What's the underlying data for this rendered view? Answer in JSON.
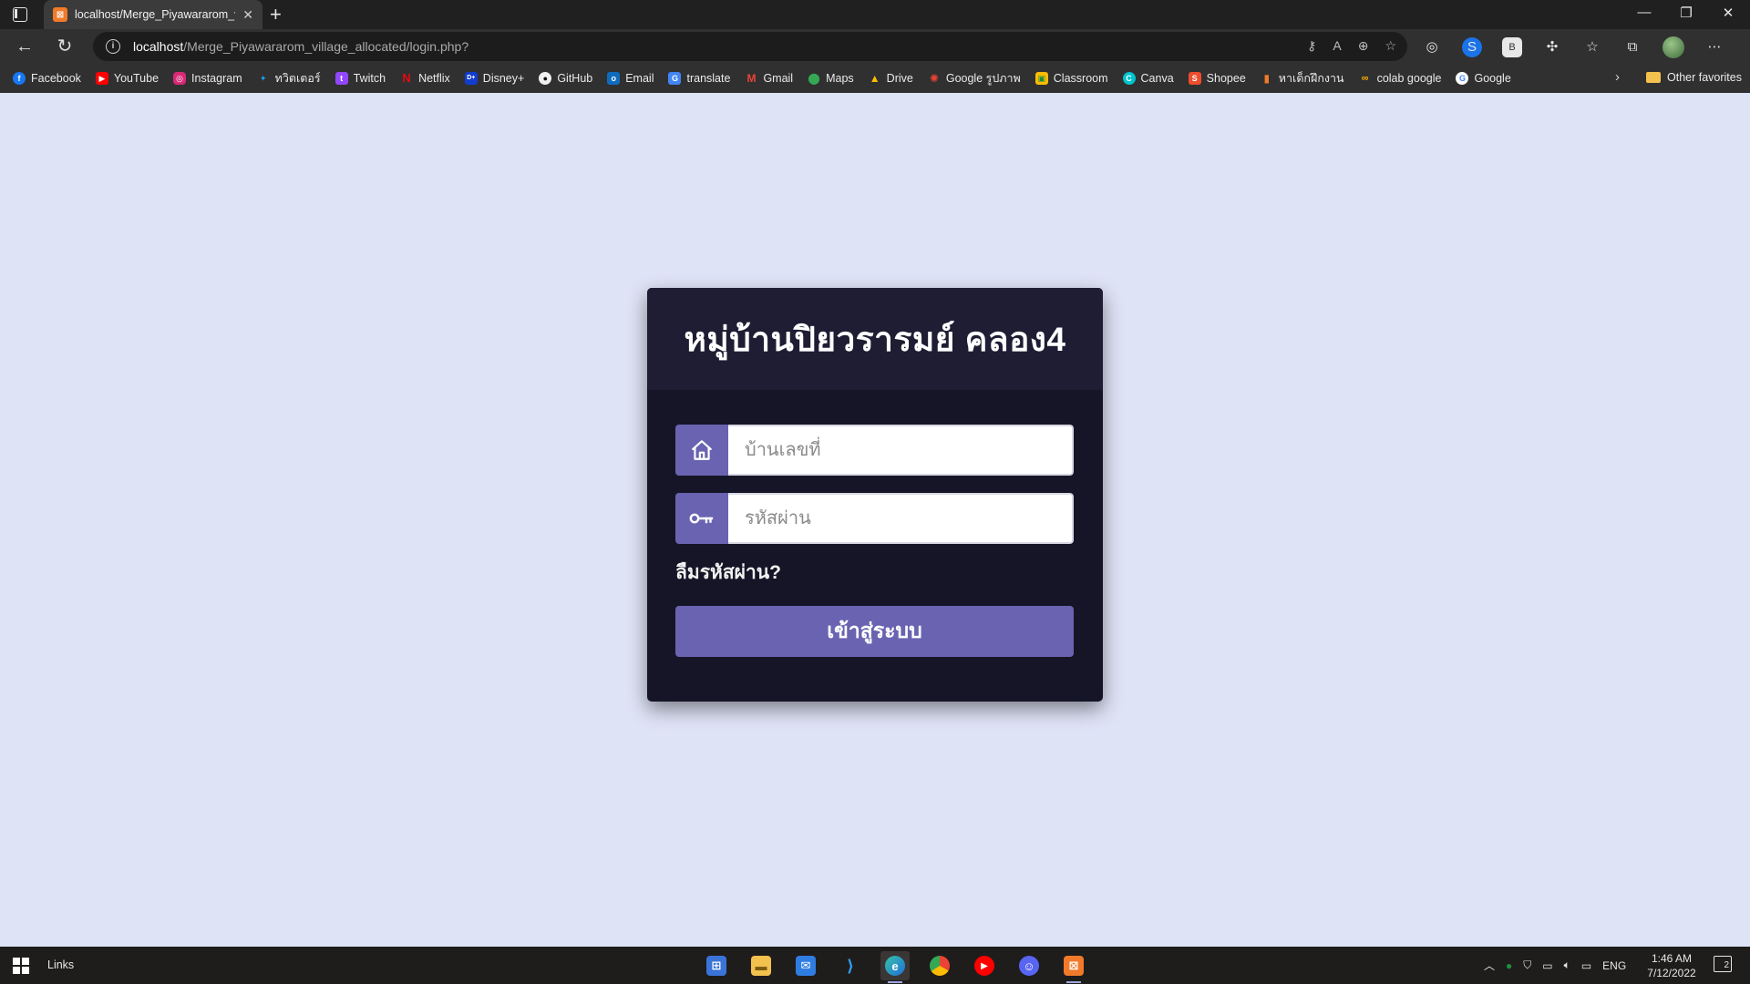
{
  "browser": {
    "tab_title": "localhost/Merge_Piyawararom_v",
    "url_host": "localhost",
    "url_path": "/Merge_Piyawararom_village_allocated/login.php?",
    "bookmarks": [
      "Facebook",
      "YouTube",
      "Instagram",
      "ทวิตเตอร์",
      "Twitch",
      "Netflix",
      "Disney+",
      "GitHub",
      "Email",
      "translate",
      "Gmail",
      "Maps",
      "Drive",
      "Google รูปภาพ",
      "Classroom",
      "Canva",
      "Shopee",
      "หาเด็กฝึกงาน",
      "colab google",
      "Google"
    ],
    "other_favorites": "Other favorites"
  },
  "login": {
    "title": "หมู่บ้านปิยวรารมย์ คลอง4",
    "house_no_placeholder": "บ้านเลขที่",
    "password_placeholder": "รหัสผ่าน",
    "forgot_label": "ลืมรหัสผ่าน?",
    "submit_label": "เข้าสู่ระบบ"
  },
  "taskbar": {
    "links_label": "Links",
    "lang": "ENG",
    "time": "1:46 AM",
    "date": "7/12/2022",
    "notification_count": "2"
  },
  "colors": {
    "page_bg": "#dfe3f6",
    "card_bg": "#161527",
    "header_bg": "#1e1d33",
    "accent": "#6a63b1"
  }
}
